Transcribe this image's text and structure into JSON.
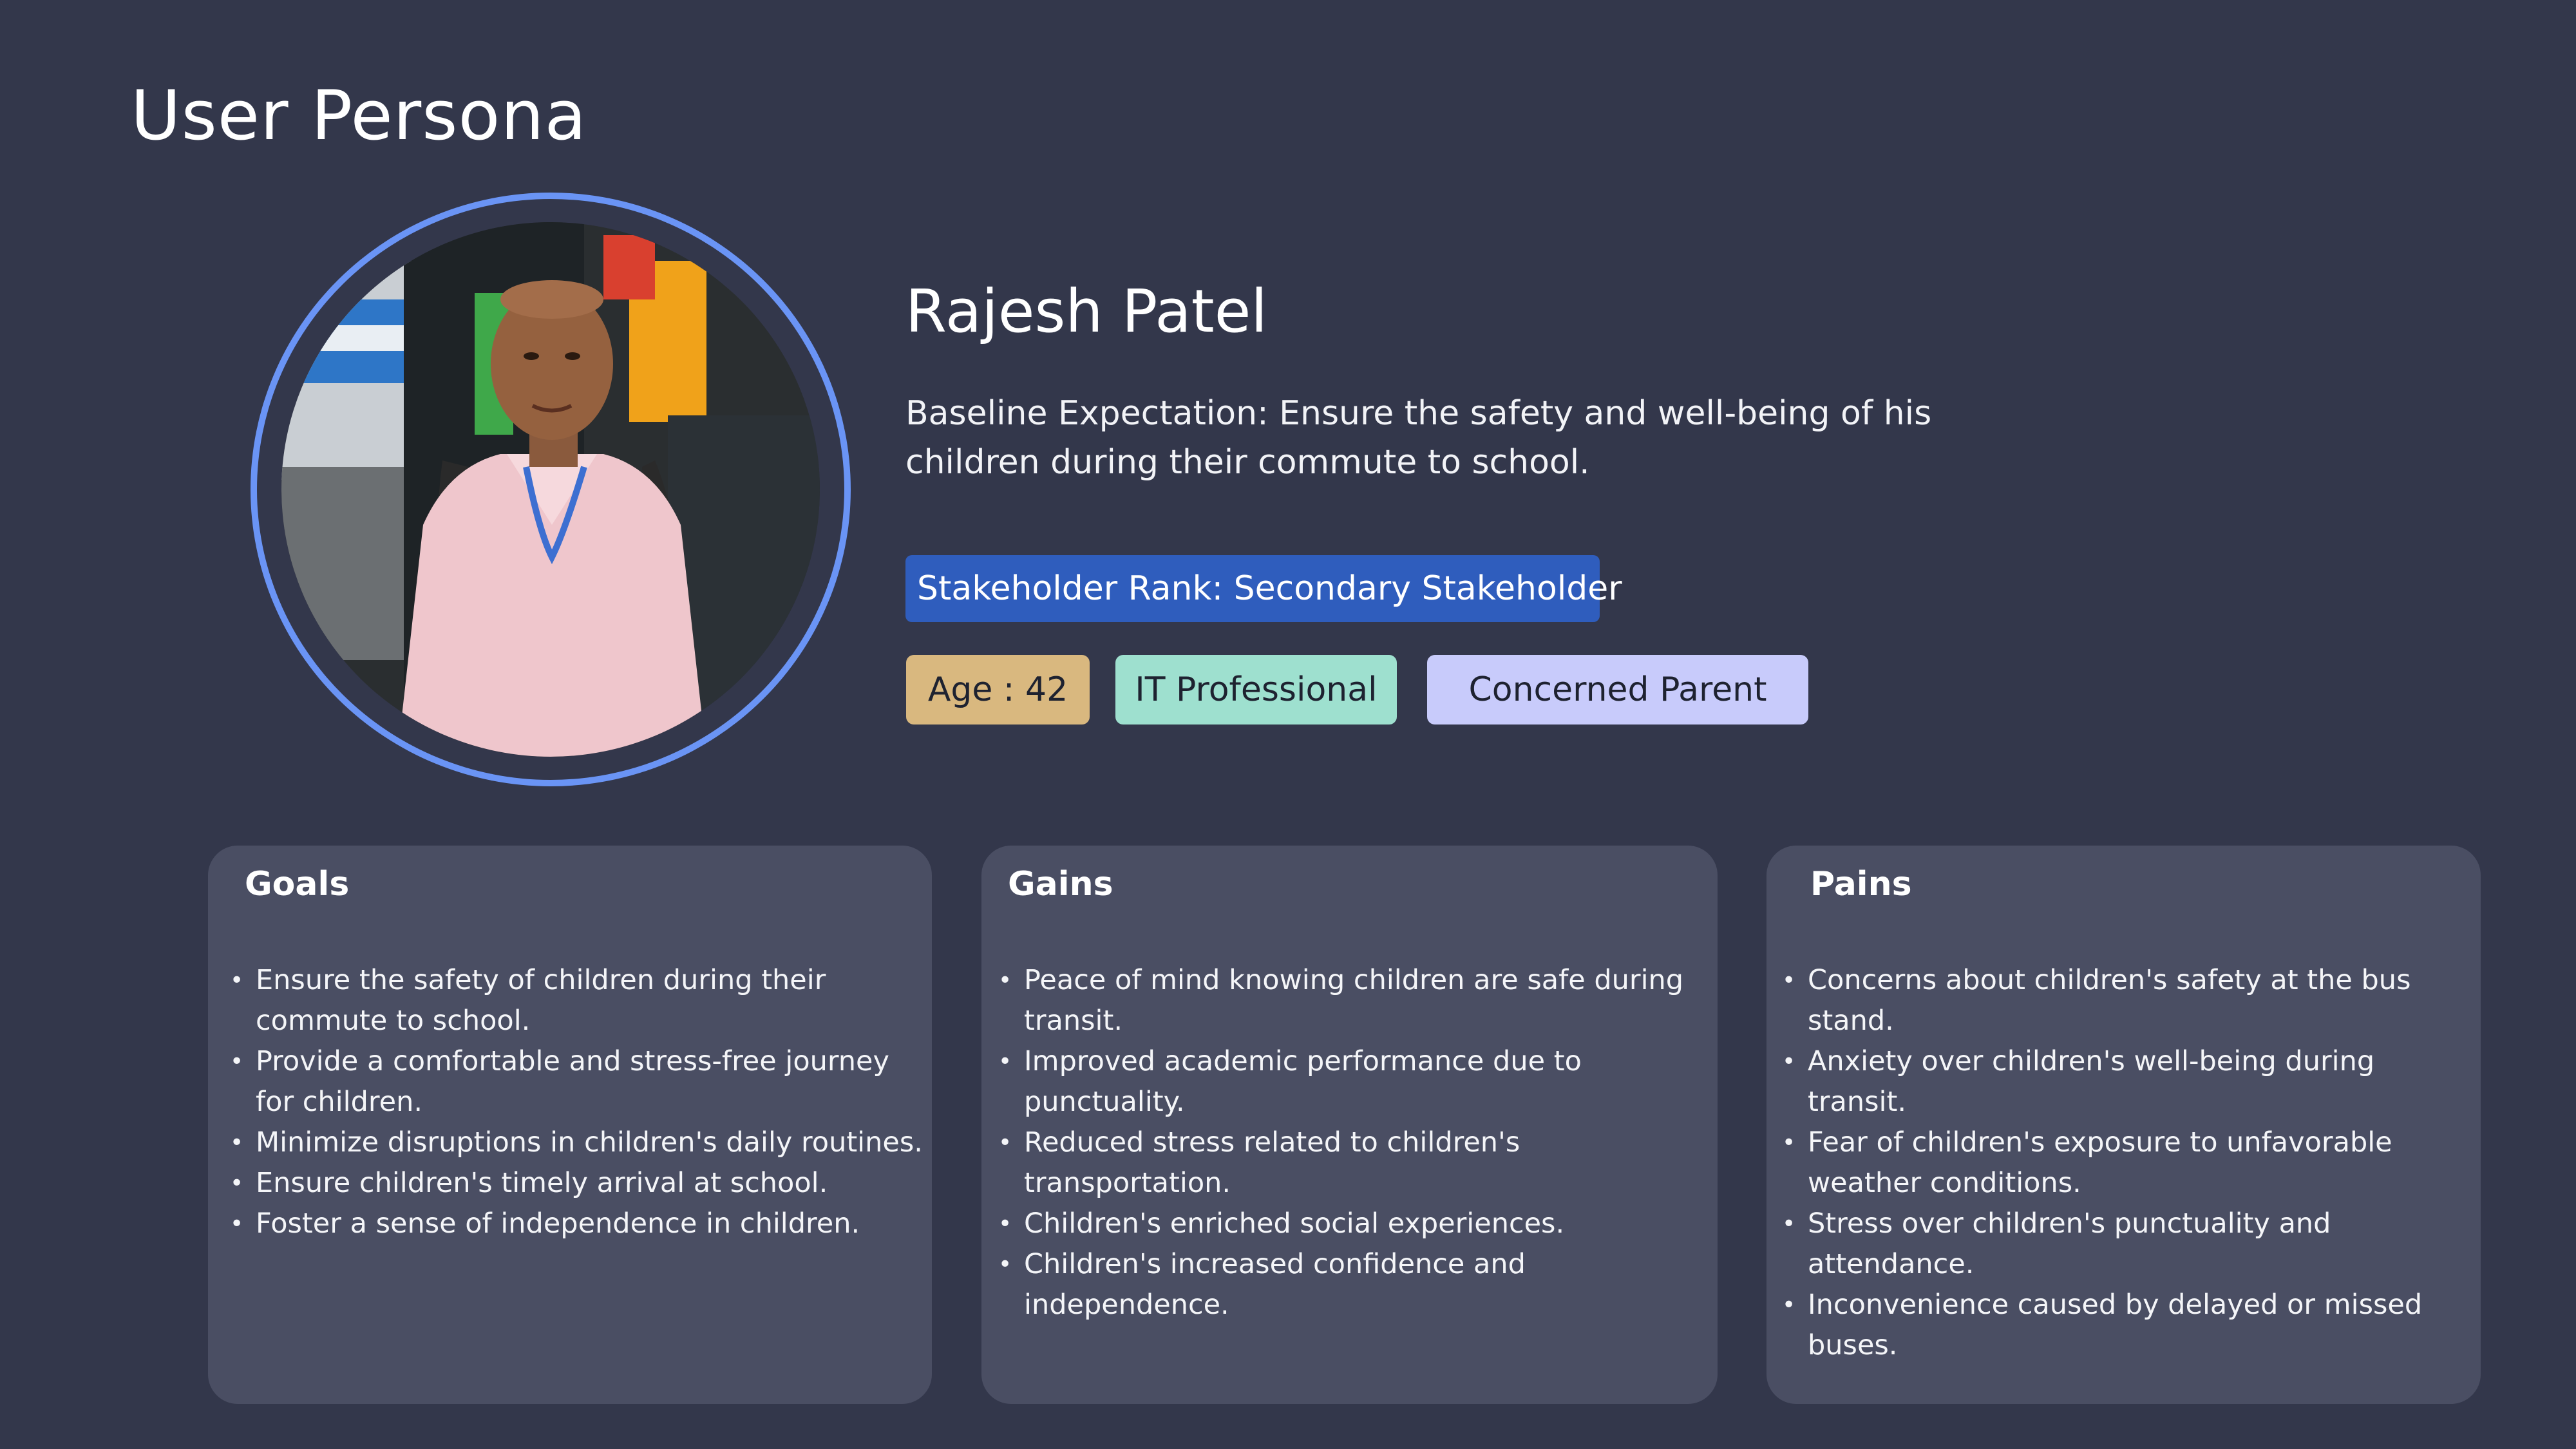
{
  "page": {
    "title": "User Persona"
  },
  "persona": {
    "name": "Rajesh Patel",
    "baseline": "Baseline Expectation: Ensure the safety and well-being of his children during their commute to school.",
    "rank": "Stakeholder Rank: Secondary Stakeholder",
    "tags": {
      "age": "Age : 42",
      "occupation": "IT Professional",
      "role": "Concerned Parent"
    },
    "photo_description_icon": "person-photo"
  },
  "cards": {
    "goals": {
      "title": "Goals",
      "items": [
        "Ensure the safety of children during their commute to school.",
        "Provide a comfortable and stress-free journey for children.",
        "Minimize disruptions in children's daily routines.",
        "Ensure children's timely arrival at school.",
        "Foster a sense of independence in children."
      ]
    },
    "gains": {
      "title": "Gains",
      "items": [
        "Peace of mind knowing children are safe during transit.",
        "Improved academic performance due to punctuality.",
        "Reduced stress related to children's transportation.",
        "Children's enriched social experiences.",
        "Children's increased confidence and independence."
      ]
    },
    "pains": {
      "title": "Pains",
      "items": [
        "Concerns about children's safety at the bus stand.",
        "Anxiety over children's well-being during transit.",
        "Fear of children's exposure to unfavorable weather conditions.",
        "Stress over children's punctuality and attendance.",
        "Inconvenience caused by delayed or missed buses."
      ]
    }
  },
  "colors": {
    "background": "#33374b",
    "card": "#4a4e63",
    "ring": "#6a94f5",
    "rank_badge": "#2f5dbd",
    "tag_age": "#d9b87f",
    "tag_job": "#9ee0cf",
    "tag_role": "#c8cbfb"
  }
}
